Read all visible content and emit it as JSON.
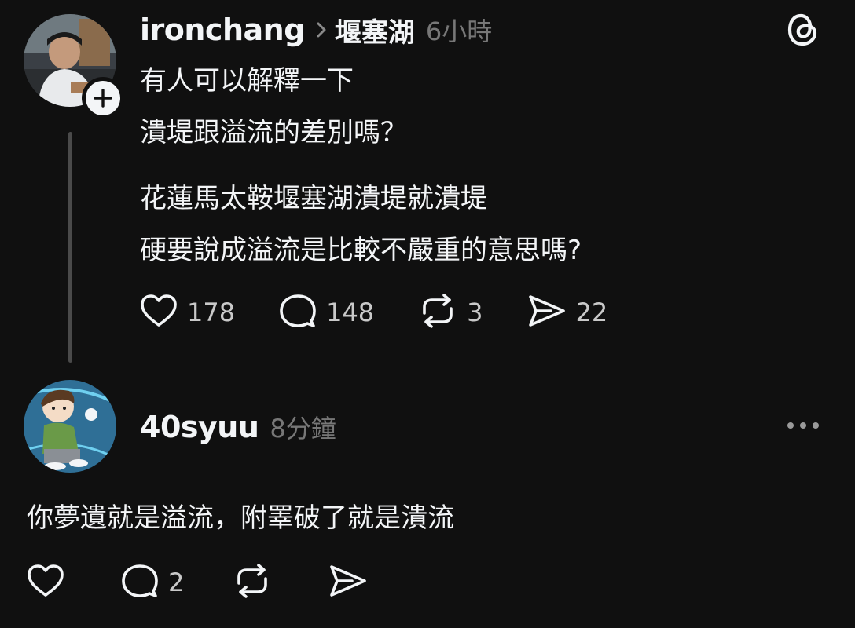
{
  "post": {
    "username": "ironchang",
    "topic": "堰塞湖",
    "time": "6小時",
    "paragraph1": [
      "有人可以解釋一下",
      "潰堤跟溢流的差別嗎？"
    ],
    "paragraph2": [
      "花蓮馬太鞍堰塞湖潰堤就潰堤",
      "硬要說成溢流是比較不嚴重的意思嗎?"
    ],
    "stats": {
      "likes": "178",
      "replies": "148",
      "reposts": "3",
      "shares": "22"
    }
  },
  "reply": {
    "username": "40syuu",
    "time": "8分鐘",
    "text": "你夢遺就是溢流，附睪破了就是潰流",
    "stats": {
      "replies": "2"
    }
  },
  "colors": {
    "background": "#101010",
    "text": "#f3f5f7",
    "muted": "#777777",
    "thread_line": "#4a4a4a"
  },
  "icons": {
    "app": "threads-logo-icon",
    "follow": "plus-icon",
    "topic_separator": "chevron-right-icon",
    "like": "heart-icon",
    "reply": "comment-icon",
    "repost": "repost-icon",
    "share": "send-icon",
    "more": "more-icon"
  }
}
